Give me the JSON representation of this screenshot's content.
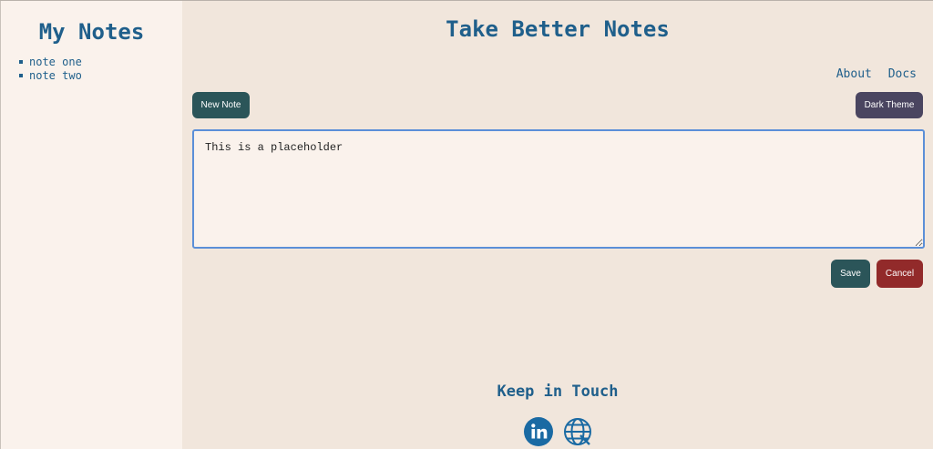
{
  "sidebar": {
    "title": "My Notes",
    "notes": [
      "note one",
      "note two"
    ]
  },
  "header": {
    "title": "Take Better Notes",
    "links": [
      "About",
      "Docs"
    ]
  },
  "toolbar": {
    "new_note_label": "New Note",
    "dark_theme_label": "Dark Theme"
  },
  "editor": {
    "value": "This is a placeholder"
  },
  "actions": {
    "save_label": "Save",
    "cancel_label": "Cancel"
  },
  "footer": {
    "title": "Keep in Touch",
    "icons": [
      "linkedin-icon",
      "globe-icon"
    ]
  },
  "colors": {
    "accent": "#1f5f8b",
    "primary_button": "#2b5559",
    "dark_button": "#4a4560",
    "danger_button": "#922a2a",
    "sidebar_bg": "#faf2ec",
    "main_bg": "#f1e6dc"
  }
}
